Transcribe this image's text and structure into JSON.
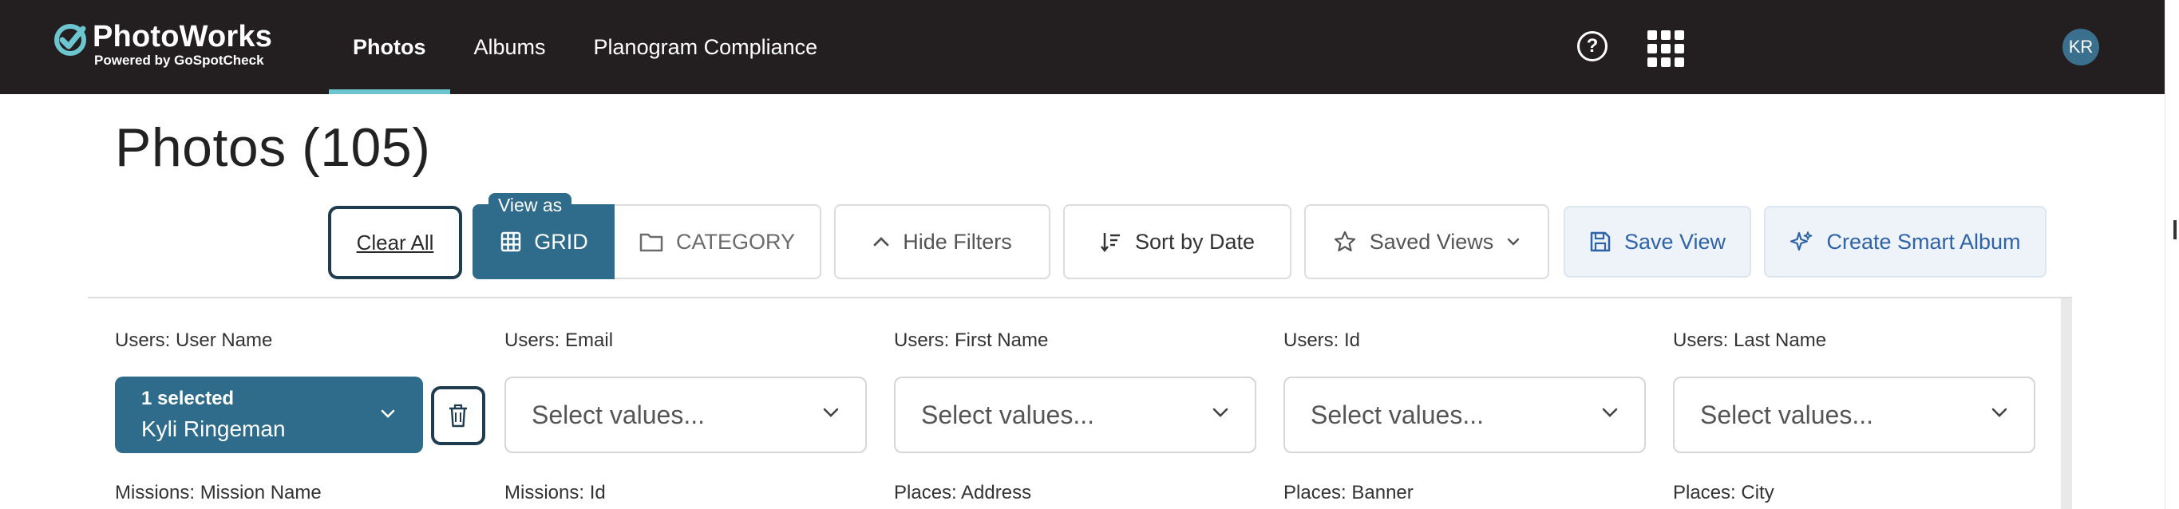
{
  "app": {
    "name": "PhotoWorks",
    "tagline": "Powered by GoSpotCheck"
  },
  "nav": {
    "items": [
      {
        "label": "Photos",
        "active": true
      },
      {
        "label": "Albums",
        "active": false
      },
      {
        "label": "Planogram Compliance",
        "active": false
      }
    ],
    "help_icon": "question-circle-icon",
    "apps_icon": "grid-apps-icon",
    "user_initials": "KR"
  },
  "page": {
    "title": "Photos (105)"
  },
  "toolbar": {
    "clear_all": "Clear All",
    "view_as_label": "View as",
    "grid_label": "GRID",
    "category_label": "CATEGORY",
    "hide_filters": "Hide Filters",
    "sort_label": "Sort by Date",
    "saved_views": "Saved Views",
    "save_view": "Save View",
    "create_smart_album": "Create Smart Album"
  },
  "filters": {
    "row1": [
      {
        "label": "Users: User Name",
        "selected_count": "1 selected",
        "selected_value": "Kyli Ringeman"
      },
      {
        "label": "Users: Email",
        "placeholder": "Select values..."
      },
      {
        "label": "Users: First Name",
        "placeholder": "Select values..."
      },
      {
        "label": "Users: Id",
        "placeholder": "Select values..."
      },
      {
        "label": "Users: Last Name",
        "placeholder": "Select values..."
      }
    ],
    "row2": [
      {
        "label": "Missions: Mission Name"
      },
      {
        "label": "Missions: Id"
      },
      {
        "label": "Places: Address"
      },
      {
        "label": "Places: Banner"
      },
      {
        "label": "Places: City"
      }
    ]
  },
  "colors": {
    "topbar": "#231f20",
    "accent": "#2f6b8a",
    "nav_underline": "#6cc5cf",
    "link_blue": "#2f63a8"
  }
}
